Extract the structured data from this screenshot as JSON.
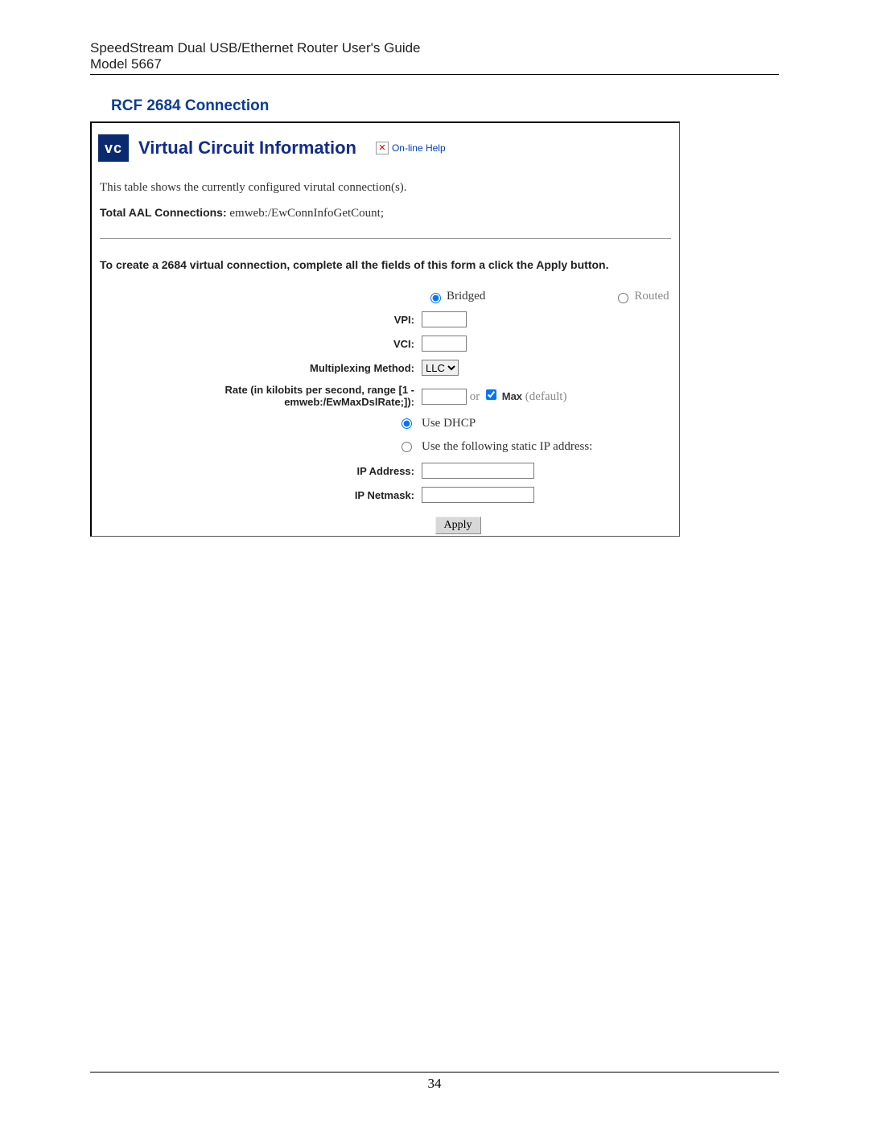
{
  "page": {
    "doc_title": "SpeedStream Dual USB/Ethernet Router User's Guide",
    "model_line": "Model 5667",
    "number": "34"
  },
  "section": {
    "heading": "RCF 2684 Connection"
  },
  "vc": {
    "badge": "vc",
    "title": "Virtual Circuit Information",
    "help_label": "On-line Help",
    "description": "This table shows the currently configured virutal connection(s).",
    "total_label": "Total AAL Connections:",
    "total_value": "emweb:/EwConnInfoGetCount;",
    "instruction": "To create a 2684 virtual connection, complete all the fields of this form a click the Apply button."
  },
  "form": {
    "mode": {
      "bridged": "Bridged",
      "routed": "Routed"
    },
    "vpi_label": "VPI:",
    "vci_label": "VCI:",
    "mux_label": "Multiplexing Method:",
    "mux_value": "LLC",
    "rate_label": "Rate (in kilobits per second, range [1 - emweb:/EwMaxDslRate;]):",
    "rate_or": "or",
    "rate_max": "Max",
    "rate_default": "(default)",
    "dhcp_label": "Use DHCP",
    "static_label": "Use the following static IP address:",
    "ipaddr_label": "IP Address:",
    "netmask_label": "IP Netmask:",
    "apply": "Apply"
  }
}
